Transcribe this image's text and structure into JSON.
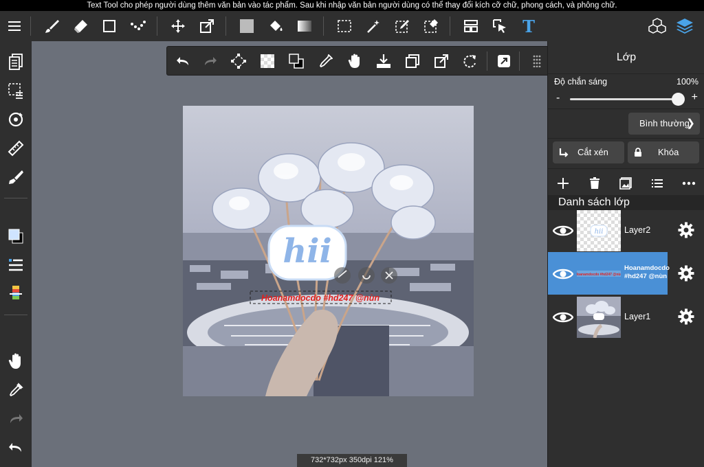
{
  "hint_text": "Text Tool cho phép người dùng thêm văn bản vào tác phẩm. Sau khi nhập văn bản người dùng có thể thay đổi kích cỡ chữ, phong cách, và phông chữ.",
  "top_toolbar": {
    "items": [
      "menu-icon",
      "brush-icon",
      "eraser-icon",
      "rectangle-icon",
      "dot-brush-icon",
      "move-icon",
      "transform-icon",
      "fill-color-icon",
      "bucket-icon",
      "gradient-icon",
      "select-rect-icon",
      "magic-wand-icon",
      "select-pen-icon",
      "select-eraser-icon",
      "reference-icon",
      "select-layer-icon",
      "text-icon",
      "materials-icon",
      "layers-icon"
    ],
    "text_tool_glyph": "T"
  },
  "colors": {
    "accent": "#4aa3e8",
    "panel_bg": "#2f2f2f",
    "canvas_bg": "#6b707a",
    "selected_layer": "#4a90d6",
    "primary_color": "#cfe4ff",
    "secondary_color": "#000000"
  },
  "floating_toolbar": {
    "items": [
      "undo-icon",
      "redo-icon",
      "transform-select-icon",
      "transparency-icon",
      "swap-color-icon",
      "eyedropper-icon",
      "hand-icon",
      "save-icon",
      "copy-layer-icon",
      "resize-icon",
      "rotate-icon",
      "share-icon",
      "grip-icon"
    ]
  },
  "canvas": {
    "text_layer_content": "Hoanamdocdo #hd247 @nùn",
    "sticker_text": "hii",
    "status": "732*732px 350dpi 121%"
  },
  "layer_panel": {
    "title": "Lớp",
    "opacity_label": "Độ chắn sáng",
    "opacity_value": "100%",
    "opacity_fraction": 1.0,
    "minus": "-",
    "plus": "+",
    "blend_mode": "Bình thường",
    "clip_label": "Cắt xén",
    "lock_label": "Khóa",
    "actions": [
      "add-icon",
      "trash-icon",
      "image-icon",
      "list-icon",
      "more-icon"
    ],
    "list_header": "Danh sách lớp",
    "layers": [
      {
        "name": "Layer2",
        "selected": false
      },
      {
        "name": "Hoanamdocdo #hd247 @nùn",
        "selected": true
      },
      {
        "name": "Layer1",
        "selected": false
      }
    ]
  }
}
